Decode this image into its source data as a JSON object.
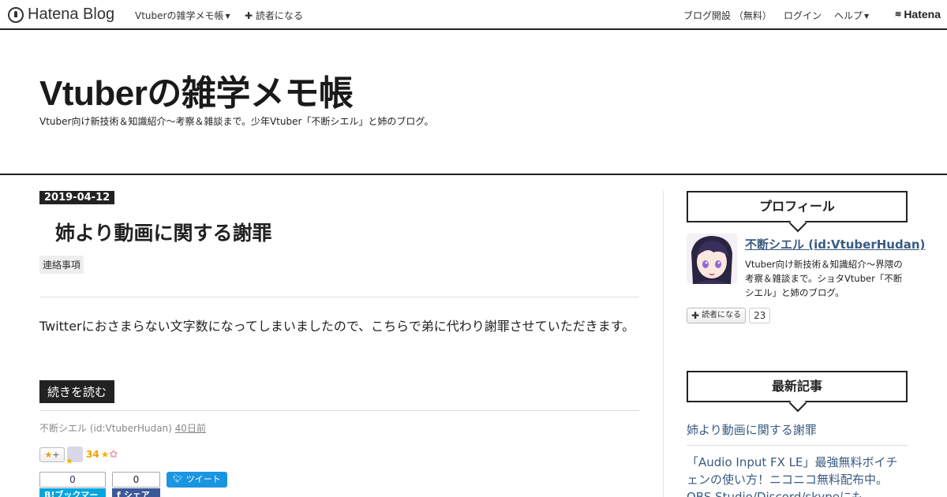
{
  "topbar": {
    "brand": "Hatena Blog",
    "blog_menu": "Vtuberの雑学メモ帳",
    "subscribe": "読者になる",
    "open_blog": "ブログ開設 （無料）",
    "login": "ログイン",
    "help": "ヘルプ",
    "hatena": "Hatena"
  },
  "header": {
    "title": "Vtuberの雑学メモ帳",
    "description": "Vtuber向け新技術＆知識紹介～考察＆雑談まで。少年Vtuber「不断シエル」と姉のブログ。"
  },
  "entry": {
    "date": "2019-04-12",
    "title": "姉より動画に関する謝罪",
    "category": "連絡事項",
    "body": "Twitterにおさまらない文字数になってしまいましたので、こちらで弟に代わり謝罪させていただきます。",
    "read_more": "続きを読む",
    "author": "不断シエル (id:VtuberHudan)",
    "time_ago": "40日前",
    "add_star": "+",
    "star_count": "34",
    "bookmark_count": "0",
    "bookmark_label": "B!ブックマーク",
    "facebook_count": "0",
    "facebook_label": "シェア",
    "tweet_label": "ツイート"
  },
  "sidebar": {
    "profile_title": "プロフィール",
    "profile_name": "不断シエル (id:VtuberHudan)",
    "profile_desc": "Vtuber向け新技術＆知識紹介～界隈の考察＆雑談まで。ショタVtuber「不断シエル」と姉のブログ。",
    "subscribe_label": "読者になる",
    "subscriber_count": "23",
    "recent_title": "最新記事",
    "recent_items": [
      "姉より動画に関する謝罪",
      "「Audio Input FX LE」最強無料ボイチェンの使い方！ニコニコ無料配布中。OBS Studio/Discord/skypeにも"
    ]
  },
  "colors": {
    "link": "#3a5a82",
    "tweet": "#1b95e0",
    "bookmark": "#00a4de",
    "facebook": "#3b5998",
    "star": "#f4b400"
  }
}
